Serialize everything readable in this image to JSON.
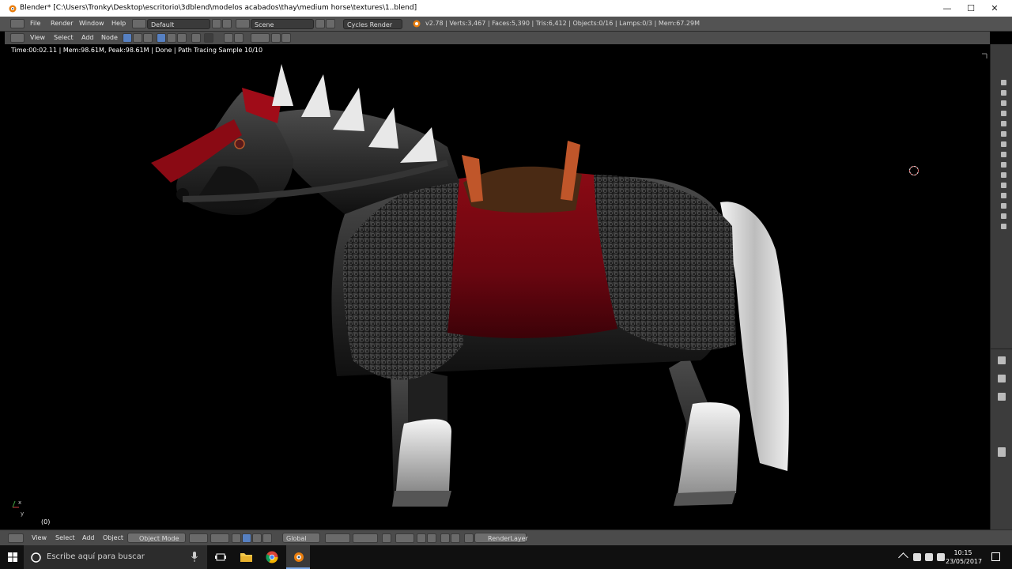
{
  "window": {
    "title": "Blender* [C:\\Users\\Tronky\\Desktop\\escritorio\\3dblend\\modelos acabados\\thay\\medium horse\\textures\\1..blend]",
    "minimize": "—",
    "maximize": "☐",
    "close": "✕"
  },
  "info_header": {
    "menus": [
      "File",
      "Render",
      "Window",
      "Help"
    ],
    "layout": "Default",
    "scene": "Scene",
    "engine": "Cycles Render",
    "stats": "v2.78 | Verts:3,467 | Faces:5,390 | Tris:6,412 | Objects:0/16 | Lamps:0/3 | Mem:67.29M"
  },
  "node_header": {
    "menus": [
      "View",
      "Select",
      "Add",
      "Node"
    ]
  },
  "viewport": {
    "render_info": "Time:00:02.11 | Mem:98.61M, Peak:98.61M | Done | Path Tracing Sample 10/10",
    "frame": "(0)",
    "axis_x": "x",
    "axis_y": "y",
    "background": "#000000"
  },
  "bottom_header": {
    "menus": [
      "View",
      "Select",
      "Add",
      "Object"
    ],
    "mode": "Object Mode",
    "orientation": "Global",
    "render_layer": "RenderLayer"
  },
  "taskbar": {
    "search_placeholder": "Escribe aquí para buscar",
    "time": "10:15",
    "date": "23/05/2017"
  },
  "colors": {
    "accent": "#5680c2",
    "header": "#4d4d4d",
    "blender_orange": "#e87d0d"
  }
}
